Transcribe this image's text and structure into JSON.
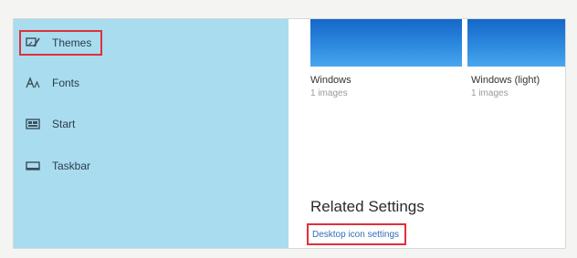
{
  "sidebar": {
    "items": [
      {
        "label": "Themes",
        "icon": "themes-icon",
        "selected": true
      },
      {
        "label": "Fonts",
        "icon": "fonts-icon",
        "selected": false
      },
      {
        "label": "Start",
        "icon": "start-icon",
        "selected": false
      },
      {
        "label": "Taskbar",
        "icon": "taskbar-icon",
        "selected": false
      }
    ]
  },
  "themes": [
    {
      "name": "Windows",
      "count": "1 images"
    },
    {
      "name": "Windows (light)",
      "count": "1 images"
    }
  ],
  "related": {
    "heading": "Related Settings",
    "link_label": "Desktop icon settings"
  },
  "colors": {
    "sidebar_bg": "#a9dcef",
    "highlight": "#e0303a",
    "link": "#2f6fb8",
    "thumbnail": "#1f77d0"
  }
}
